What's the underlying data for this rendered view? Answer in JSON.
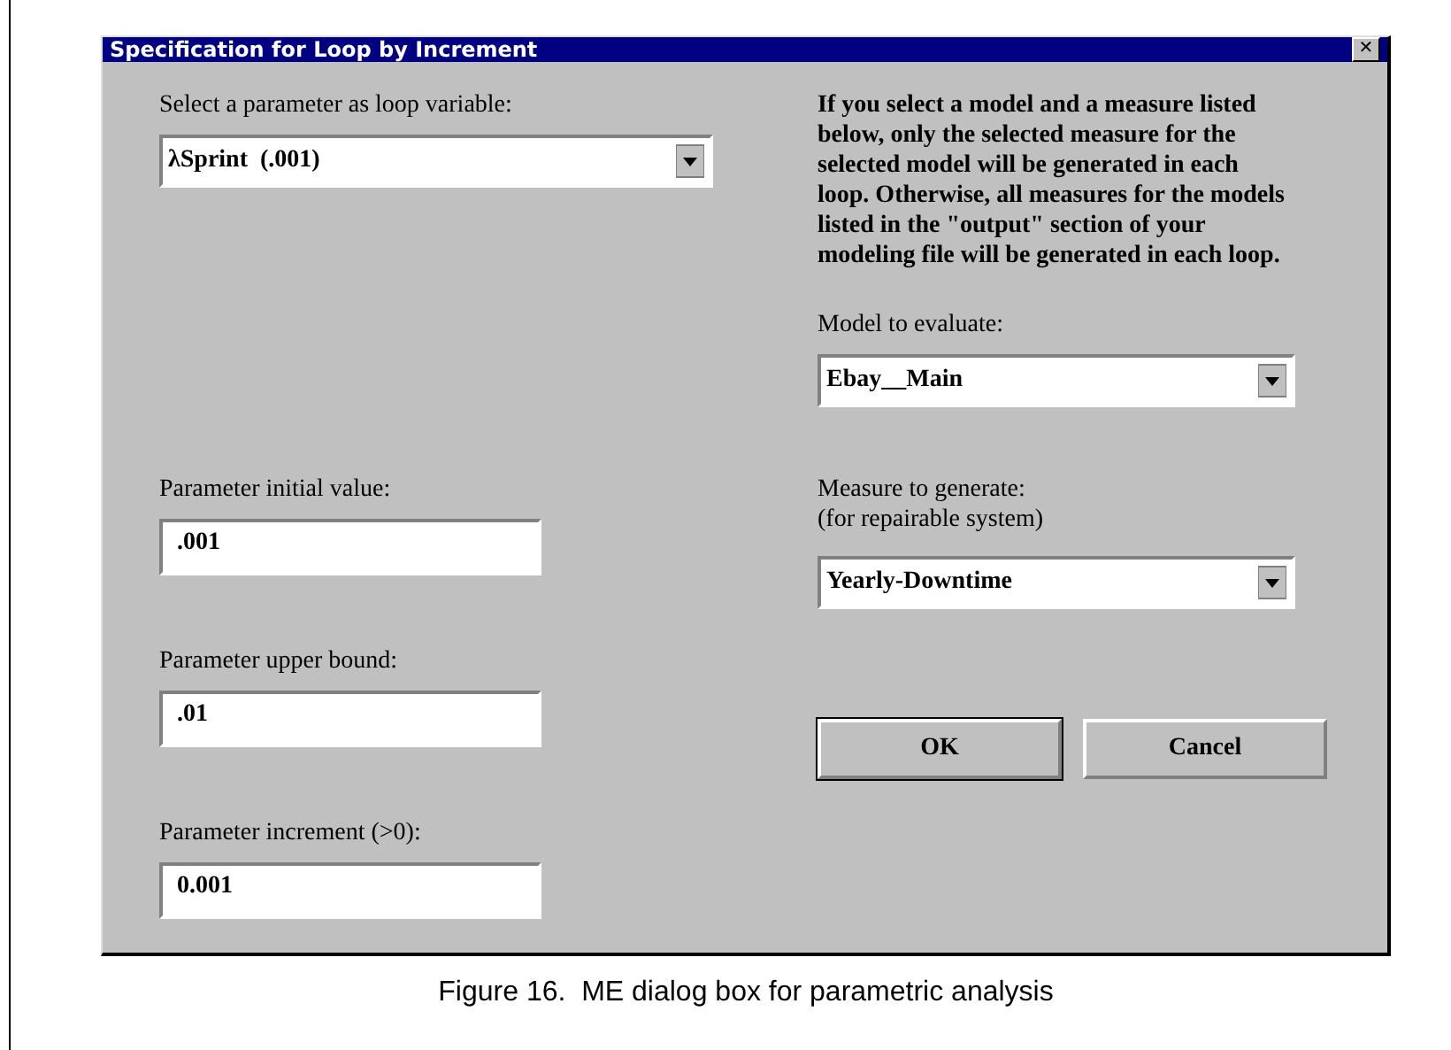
{
  "window": {
    "title": "Specification for Loop by Increment",
    "close": "✕"
  },
  "left": {
    "loop_variable": {
      "label": "Select a parameter as loop variable:",
      "value": "λSprint  (.001)"
    },
    "fields": [
      {
        "label": "Parameter initial value:",
        "value": ".001"
      },
      {
        "label": "Parameter upper bound:",
        "value": ".01"
      },
      {
        "label": "Parameter increment (>0):",
        "value": "0.001"
      }
    ]
  },
  "right": {
    "note": "If you select a model and a measure listed below, only the selected measure for the selected model will be generated in each loop. Otherwise, all measures for the models listed in the \"output\" section of your modeling file will be generated in each loop.",
    "model": {
      "label": "Model to evaluate:",
      "value": "Ebay__Main"
    },
    "measure": {
      "label": "Measure to generate:",
      "sublabel": "(for repairable system)",
      "value": "Yearly-Downtime"
    }
  },
  "buttons": [
    "OK",
    "Cancel"
  ],
  "caption": "Figure 16.  ME dialog box for parametric analysis"
}
